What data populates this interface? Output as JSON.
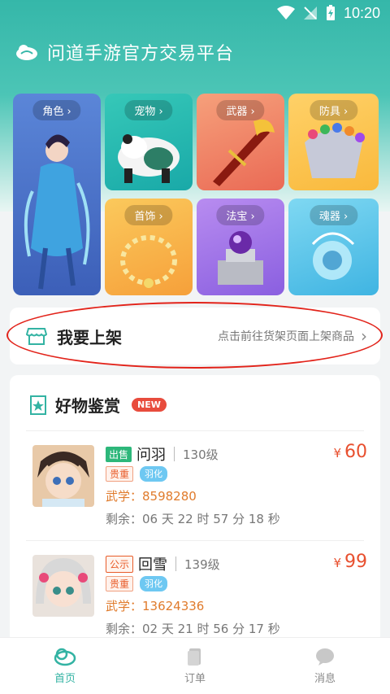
{
  "status": {
    "time": "10:20"
  },
  "header": {
    "title": "问道手游官方交易平台"
  },
  "categories": [
    {
      "label": "角色"
    },
    {
      "label": "宠物"
    },
    {
      "label": "武器"
    },
    {
      "label": "防具"
    },
    {
      "label": "首饰"
    },
    {
      "label": "法宝"
    },
    {
      "label": "魂器"
    }
  ],
  "chevron": "›",
  "listing": {
    "title": "我要上架",
    "hint": "点击前往货架页面上架商品",
    "chevron": "›"
  },
  "goods": {
    "title": "好物鉴赏",
    "badge": "NEW",
    "items": [
      {
        "status_tag": "出售",
        "name": "问羽",
        "level": "130级",
        "tags": [
          "贵重",
          "羽化"
        ],
        "wuxue": "武学：8598280",
        "remaining": "剩余：06 天 22 时 57 分 18 秒",
        "currency": "¥",
        "price": "60"
      },
      {
        "status_tag": "公示",
        "name": "回雪",
        "level": "139级",
        "tags": [
          "贵重",
          "羽化"
        ],
        "wuxue": "武学：13624336",
        "remaining": "剩余：02 天 21 时 56 分 17 秒",
        "currency": "¥",
        "price": "99"
      }
    ]
  },
  "tabbar": [
    {
      "label": "首页",
      "icon": "home-icon",
      "active": true
    },
    {
      "label": "订单",
      "icon": "order-icon",
      "active": false
    },
    {
      "label": "消息",
      "icon": "message-icon",
      "active": false
    }
  ],
  "colors": {
    "brand": "#35b7a9",
    "price": "#e8502f",
    "annotation": "#e2231a"
  }
}
